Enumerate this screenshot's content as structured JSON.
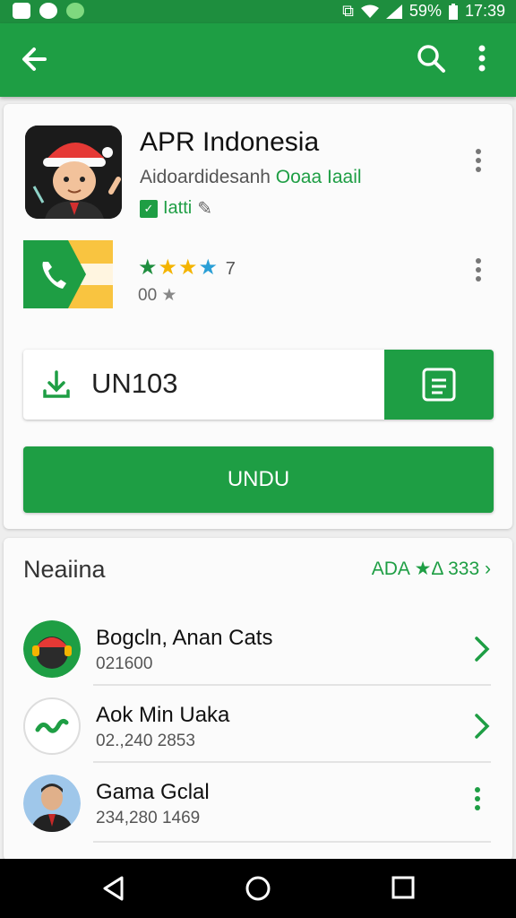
{
  "status_bar": {
    "battery": "59%",
    "time": "17:39"
  },
  "app_bar": {
    "back_icon": "back-arrow-icon",
    "search_icon": "search-icon",
    "more_icon": "more-vert-icon"
  },
  "app": {
    "title": "APR Indonesia",
    "developer": "Aidoardidesanh",
    "developer_tag": "Ooaa Iaail",
    "badge_label": "Iatti",
    "rating_value": "7",
    "rating_count": "00"
  },
  "install": {
    "label": "UN103"
  },
  "primary_button": {
    "label": "UNDU"
  },
  "section": {
    "title": "Neaiina",
    "link": "ADA ★Δ 333"
  },
  "list": [
    {
      "name": "Bogcln, Anan Cats",
      "sub": "021600"
    },
    {
      "name": "Aok Min Uaka",
      "sub": "02.,240 2853"
    },
    {
      "name": "Gama Gclal",
      "sub": "234,280 1469"
    }
  ],
  "colors": {
    "primary": "#1e9e44",
    "status_bar": "#1e8e3e",
    "star_yellow": "#f4b400",
    "star_blue": "#2a9fd6"
  }
}
